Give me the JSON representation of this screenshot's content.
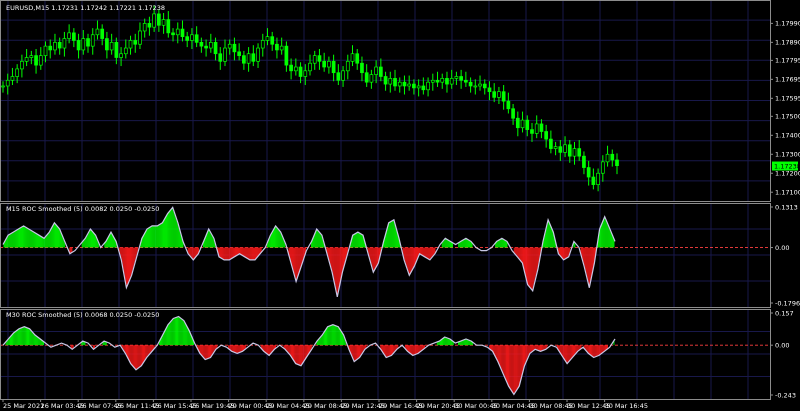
{
  "colors": {
    "background": "#000000",
    "frame": "#8c8c8c",
    "grid": "#18184a",
    "candle": "#00ff00",
    "positive": "#00ff00",
    "negative": "#ff1a1a",
    "signal": "#c8c8e6",
    "zero_line": "#ff4040",
    "price_tag_bg": "#00ff00"
  },
  "main": {
    "symbol_info": "EURUSD,M15  1.17231 1.17242 1.17221 1.17238",
    "price_tag": "1.17238",
    "price_axis": [
      "1.17990",
      "1.17890",
      "1.17795",
      "1.17695",
      "1.17595",
      "1.17500",
      "1.17400",
      "1.17300",
      "1.17200",
      "1.17100"
    ],
    "series": {
      "close": [
        1.1766,
        1.1769,
        1.1771,
        1.1775,
        1.1779,
        1.1781,
        1.1782,
        1.1777,
        1.1782,
        1.1787,
        1.1785,
        1.1789,
        1.1786,
        1.1791,
        1.1794,
        1.179,
        1.1785,
        1.1791,
        1.1787,
        1.1793,
        1.1796,
        1.1791,
        1.1785,
        1.1789,
        1.1781,
        1.1783,
        1.1786,
        1.179,
        1.1788,
        1.1795,
        1.1799,
        1.1797,
        1.1804,
        1.1798,
        1.1801,
        1.1794,
        1.1793,
        1.1796,
        1.1792,
        1.179,
        1.1793,
        1.1789,
        1.1787,
        1.1786,
        1.1789,
        1.1783,
        1.1779,
        1.1786,
        1.1788,
        1.1784,
        1.1782,
        1.1778,
        1.1783,
        1.1779,
        1.1786,
        1.179,
        1.1792,
        1.1788,
        1.1785,
        1.1787,
        1.1777,
        1.1774,
        1.1776,
        1.1771,
        1.1774,
        1.1778,
        1.1782,
        1.1779,
        1.1776,
        1.1779,
        1.1773,
        1.1769,
        1.1774,
        1.1779,
        1.1783,
        1.1778,
        1.1773,
        1.1768,
        1.1772,
        1.1776,
        1.1771,
        1.1767,
        1.177,
        1.1766,
        1.1768,
        1.1766,
        1.1767,
        1.1765,
        1.1766,
        1.1764,
        1.1768,
        1.1769,
        1.1768,
        1.177,
        1.1767,
        1.177,
        1.1771,
        1.1769,
        1.1768,
        1.1766,
        1.1766,
        1.1767,
        1.1765,
        1.1763,
        1.176,
        1.1763,
        1.1758,
        1.1754,
        1.1749,
        1.1744,
        1.1748,
        1.1743,
        1.1741,
        1.1746,
        1.1742,
        1.1738,
        1.1733,
        1.1734,
        1.1731,
        1.1735,
        1.1729,
        1.1733,
        1.1729,
        1.1723,
        1.1718,
        1.1714,
        1.172,
        1.1726,
        1.173,
        1.1727,
        1.1724
      ]
    }
  },
  "roc_m15": {
    "label": "M15 ROC Smoothed (5) 0.0082 0.0250 -0.0250",
    "axis": [
      "0.1313",
      "0.00",
      "-0.1796"
    ],
    "range": [
      -0.1796,
      0.1313
    ],
    "values": [
      0.01,
      0.04,
      0.05,
      0.06,
      0.07,
      0.06,
      0.05,
      0.04,
      0.03,
      0.05,
      0.08,
      0.06,
      0.02,
      -0.02,
      -0.01,
      0.01,
      0.03,
      0.06,
      0.04,
      0.0,
      0.02,
      0.05,
      0.02,
      -0.04,
      -0.13,
      -0.09,
      -0.03,
      0.03,
      0.06,
      0.07,
      0.07,
      0.08,
      0.11,
      0.13,
      0.08,
      0.02,
      -0.02,
      -0.04,
      -0.02,
      0.02,
      0.06,
      0.03,
      -0.03,
      -0.04,
      -0.04,
      -0.03,
      -0.02,
      -0.03,
      -0.04,
      -0.04,
      -0.02,
      0.0,
      0.04,
      0.07,
      0.05,
      0.01,
      -0.05,
      -0.11,
      -0.06,
      -0.01,
      0.02,
      0.06,
      0.04,
      -0.02,
      -0.08,
      -0.16,
      -0.08,
      -0.02,
      0.04,
      0.05,
      0.04,
      -0.02,
      -0.08,
      -0.05,
      0.02,
      0.08,
      0.09,
      0.03,
      -0.04,
      -0.09,
      -0.06,
      -0.02,
      -0.03,
      -0.04,
      -0.02,
      0.01,
      0.03,
      0.02,
      0.01,
      0.02,
      0.03,
      0.02,
      0.0,
      -0.01,
      -0.01,
      0.0,
      0.02,
      0.03,
      0.02,
      -0.01,
      -0.03,
      -0.05,
      -0.12,
      -0.14,
      -0.07,
      0.02,
      0.09,
      0.05,
      -0.02,
      -0.04,
      -0.03,
      0.02,
      0.0,
      -0.06,
      -0.13,
      -0.05,
      0.06,
      0.1,
      0.06,
      0.02
    ]
  },
  "roc_m30": {
    "label": "M30 ROC Smoothed (5) 0.0068 0.0250 -0.0250",
    "axis": [
      "0.157",
      "0.00",
      "-0.243"
    ],
    "range": [
      -0.243,
      0.157
    ],
    "values": [
      0.0,
      0.03,
      0.06,
      0.08,
      0.09,
      0.08,
      0.05,
      0.03,
      0.01,
      -0.01,
      0.0,
      0.01,
      0.0,
      -0.02,
      0.0,
      0.02,
      0.01,
      -0.02,
      0.0,
      0.02,
      0.01,
      -0.01,
      0.0,
      -0.04,
      -0.09,
      -0.12,
      -0.1,
      -0.06,
      -0.03,
      0.0,
      0.05,
      0.1,
      0.13,
      0.14,
      0.12,
      0.07,
      0.01,
      -0.04,
      -0.07,
      -0.06,
      -0.02,
      0.0,
      -0.01,
      -0.03,
      -0.04,
      -0.03,
      -0.01,
      0.01,
      0.0,
      -0.03,
      -0.05,
      -0.02,
      0.0,
      -0.02,
      -0.05,
      -0.09,
      -0.1,
      -0.06,
      -0.02,
      0.02,
      0.05,
      0.09,
      0.1,
      0.09,
      0.05,
      -0.02,
      -0.08,
      -0.06,
      -0.02,
      0.0,
      0.01,
      -0.02,
      -0.06,
      -0.05,
      -0.02,
      0.0,
      -0.03,
      -0.05,
      -0.04,
      -0.02,
      0.0,
      0.01,
      0.02,
      0.04,
      0.03,
      0.01,
      0.02,
      0.03,
      0.02,
      0.0,
      0.0,
      -0.01,
      -0.03,
      -0.08,
      -0.14,
      -0.2,
      -0.24,
      -0.2,
      -0.1,
      -0.04,
      -0.02,
      -0.03,
      -0.02,
      0.0,
      -0.01,
      -0.05,
      -0.09,
      -0.06,
      -0.03,
      -0.01,
      -0.04,
      -0.06,
      -0.05,
      -0.03,
      -0.01,
      0.03
    ]
  },
  "time_axis": [
    "25 Mar 2021",
    "26 Mar 03:45",
    "26 Mar 07:45",
    "26 Mar 11:45",
    "26 Mar 15:45",
    "26 Mar 19:45",
    "29 Mar 00:45",
    "29 Mar 04:45",
    "29 Mar 08:45",
    "29 Mar 12:45",
    "29 Mar 16:45",
    "29 Mar 20:45",
    "30 Mar 00:45",
    "30 Mar 04:45",
    "30 Mar 08:45",
    "30 Mar 12:45",
    "30 Mar 16:45"
  ]
}
